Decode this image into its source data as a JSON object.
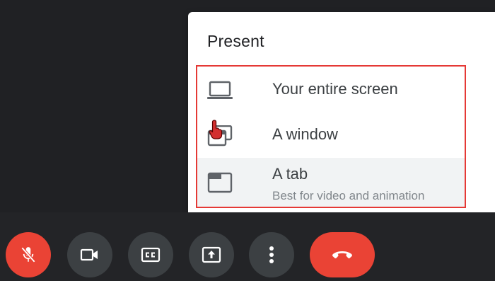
{
  "present_menu": {
    "title": "Present",
    "options": [
      {
        "label": "Your entire screen",
        "icon": "laptop-icon"
      },
      {
        "label": "A window",
        "icon": "window-icon"
      },
      {
        "label": "A tab",
        "sublabel": "Best for video and animation",
        "icon": "tab-icon"
      }
    ]
  },
  "controls": {
    "buttons": [
      {
        "name": "microphone",
        "state": "muted",
        "icon": "mic-off-icon",
        "color": "#ea4335"
      },
      {
        "name": "camera",
        "icon": "videocam-icon"
      },
      {
        "name": "captions",
        "icon": "closed-caption-icon"
      },
      {
        "name": "present-now",
        "icon": "present-to-all-icon"
      },
      {
        "name": "more-options",
        "icon": "more-vert-icon"
      },
      {
        "name": "leave-call",
        "icon": "call-end-icon",
        "color": "#ea4335"
      }
    ]
  },
  "colors": {
    "background": "#202124",
    "menu_background": "#ffffff",
    "highlight_border": "#e53935",
    "danger": "#ea4335",
    "control_button": "#3c4043"
  }
}
